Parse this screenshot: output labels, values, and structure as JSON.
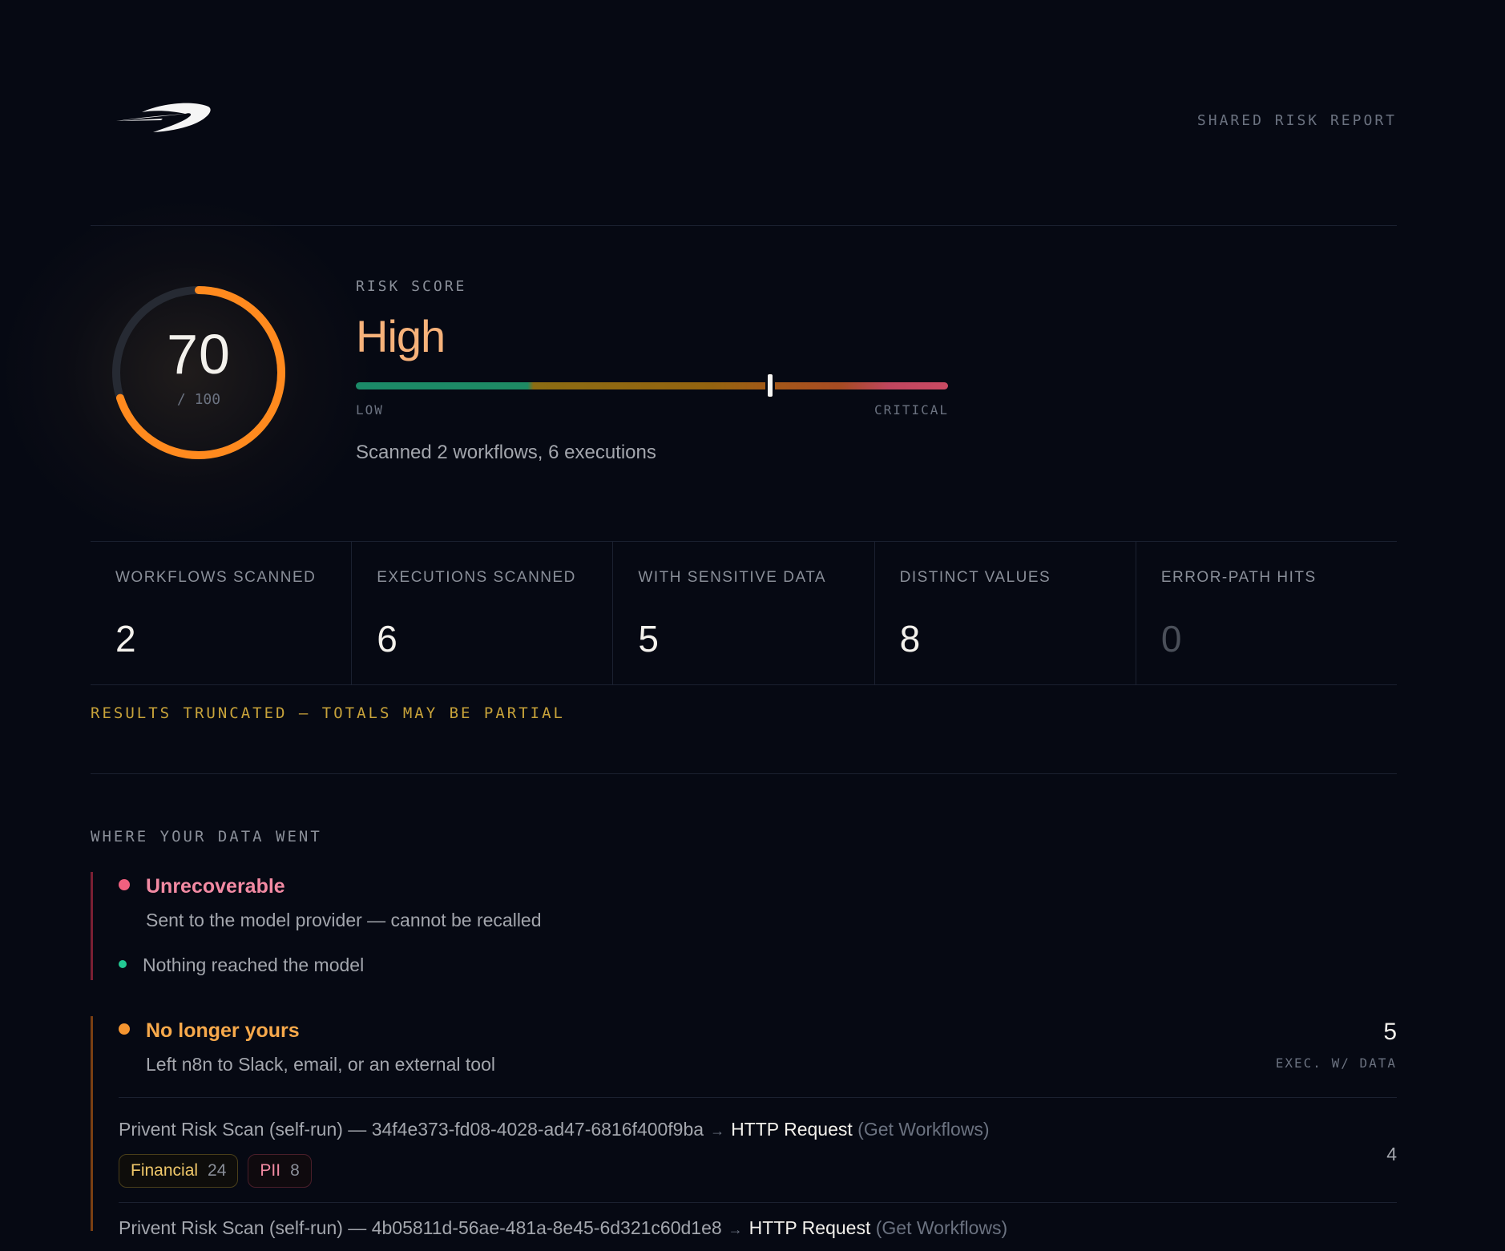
{
  "header": {
    "logo_name": "swoosh-logo",
    "report_title": "SHARED RISK REPORT"
  },
  "risk": {
    "score": "70",
    "max": "/ 100",
    "score_fraction": 0.7,
    "label": "RISK SCORE",
    "level": "High",
    "scale_low": "LOW",
    "scale_high": "CRITICAL",
    "marker_fraction": 0.7,
    "summary": "Scanned 2 workflows, 6 executions",
    "accent_color": "#ff8a1e"
  },
  "stats": [
    {
      "label": "WORKFLOWS SCANNED",
      "value": "2"
    },
    {
      "label": "EXECUTIONS SCANNED",
      "value": "6"
    },
    {
      "label": "WITH SENSITIVE DATA",
      "value": "5"
    },
    {
      "label": "DISTINCT VALUES",
      "value": "8"
    },
    {
      "label": "ERROR-PATH HITS",
      "value": "0"
    }
  ],
  "truncated_notice": "RESULTS TRUNCATED — TOTALS MAY BE PARTIAL",
  "destinations": {
    "title": "WHERE YOUR DATA WENT",
    "unrecoverable": {
      "title": "Unrecoverable",
      "description": "Sent to the model provider — cannot be recalled",
      "status": "Nothing reached the model",
      "color": "#f0607f",
      "status_color": "#22c993"
    },
    "no_longer_yours": {
      "title": "No longer yours",
      "description": "Left n8n to Slack, email, or an external tool",
      "count": "5",
      "count_label": "EXEC. W/ DATA",
      "color": "#f59530",
      "rows": [
        {
          "source": "Privent Risk Scan (self-run) — 34f4e373-fd08-4028-ad47-6816f400f9ba",
          "arrow": "→",
          "node": "HTTP Request",
          "sub": "(Get Workflows)",
          "count": "4",
          "tags": [
            {
              "label": "Financial",
              "count": "24",
              "kind": "fin"
            },
            {
              "label": "PII",
              "count": "8",
              "kind": "pii"
            }
          ]
        },
        {
          "source": "Privent Risk Scan (self-run) — 4b05811d-56ae-481a-8e45-6d321c60d1e8",
          "arrow": "→",
          "node": "HTTP Request",
          "sub": "(Get Workflows)"
        }
      ]
    }
  }
}
